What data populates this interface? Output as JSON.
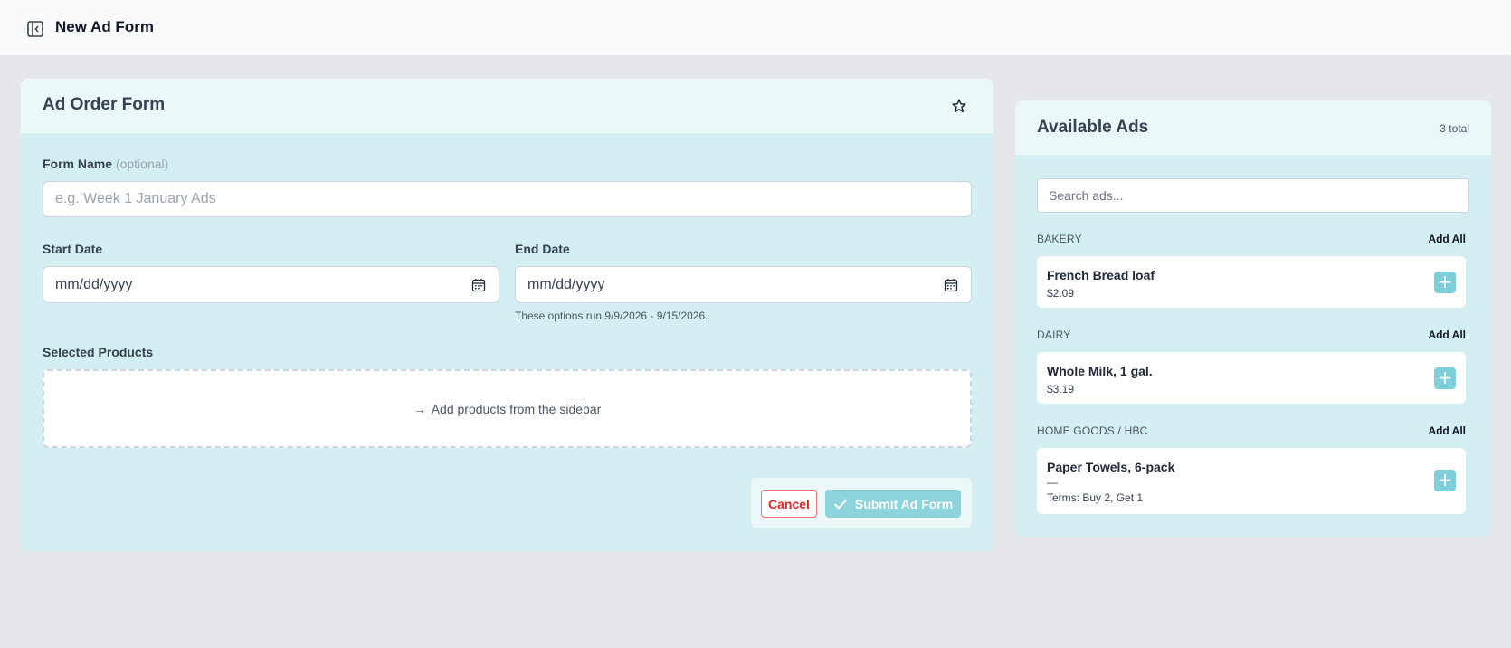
{
  "header": {
    "title": "New Ad Form"
  },
  "form": {
    "card_title": "Ad Order Form",
    "form_name": {
      "label": "Form Name",
      "optional": "(optional)",
      "placeholder": "e.g. Week 1 January Ads"
    },
    "start_date": {
      "label": "Start Date",
      "value": "mm/dd/yyyy"
    },
    "end_date": {
      "label": "End Date",
      "value": "mm/dd/yyyy"
    },
    "date_hint": "These options run 9/9/2026 - 9/15/2026.",
    "selected_products": {
      "label": "Selected Products",
      "arrow": "→",
      "empty_text": "Add products from the sidebar"
    },
    "cancel_label": "Cancel",
    "submit_label": "Submit Ad Form"
  },
  "sidebar": {
    "title": "Available Ads",
    "count": "3 total",
    "search_placeholder": "Search ads...",
    "add_all_label": "Add All",
    "categories": [
      {
        "name": "BAKERY",
        "products": [
          {
            "name": "French Bread loaf",
            "price": "$2.09"
          }
        ]
      },
      {
        "name": "DAIRY",
        "products": [
          {
            "name": "Whole Milk, 1 gal.",
            "price": "$3.19"
          }
        ]
      },
      {
        "name": "HOME GOODS / HBC",
        "products": [
          {
            "name": "Paper Towels, 6-pack",
            "price": "—",
            "terms": "Terms: Buy 2, Get 1"
          }
        ]
      }
    ]
  },
  "icons": {
    "sidebar_toggle": "sidebar-toggle-icon",
    "favorite": "star-icon",
    "calendar": "calendar-icon",
    "submit": "check-icon",
    "add": "plus-icon"
  },
  "colors": {
    "card_background": "#d3eff2",
    "card_header": "#ebf7f9",
    "accent": "#7dd0da",
    "cancel": "#dc2626"
  }
}
